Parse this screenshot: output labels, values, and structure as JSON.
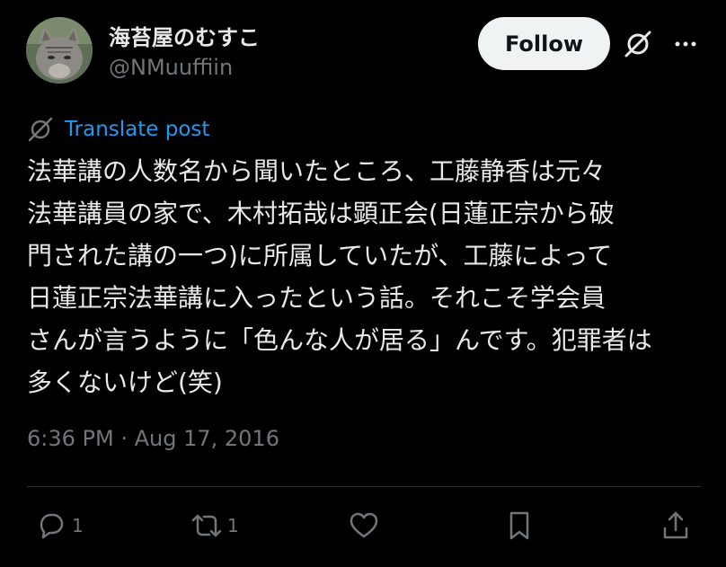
{
  "author": {
    "display_name": "海苔屋のむすこ",
    "handle": "@NMuuffiin"
  },
  "header": {
    "follow_label": "Follow"
  },
  "post": {
    "translate_label": "Translate post",
    "text": "法華講の人数名から聞いたところ、工藤静香は元々\n法華講員の家で、木村拓哉は顕正会(日蓮正宗から破\n門された講の一つ)に所属していたが、工藤によって\n日蓮正宗法華講に入ったという話。それこそ学会員\nさんが言うように「色んな人が居る」んです。犯罪者は\n多くないけど(笑)",
    "timestamp": "6:36 PM · Aug 17, 2016"
  },
  "actions": {
    "reply_count": "1",
    "repost_count": "1"
  },
  "icons": {
    "avatar": "cat-avatar",
    "grok": "grok-icon",
    "more": "more-icon",
    "translate": "grok-icon",
    "reply": "reply-icon",
    "repost": "repost-icon",
    "like": "like-icon",
    "bookmark": "bookmark-icon",
    "share": "share-icon"
  },
  "colors": {
    "background": "#000000",
    "text_primary": "#e7e9ea",
    "text_secondary": "#71767b",
    "link": "#1d9bf0",
    "follow_bg": "#eff3f4",
    "follow_text": "#0f1419",
    "divider": "#2f3336"
  }
}
